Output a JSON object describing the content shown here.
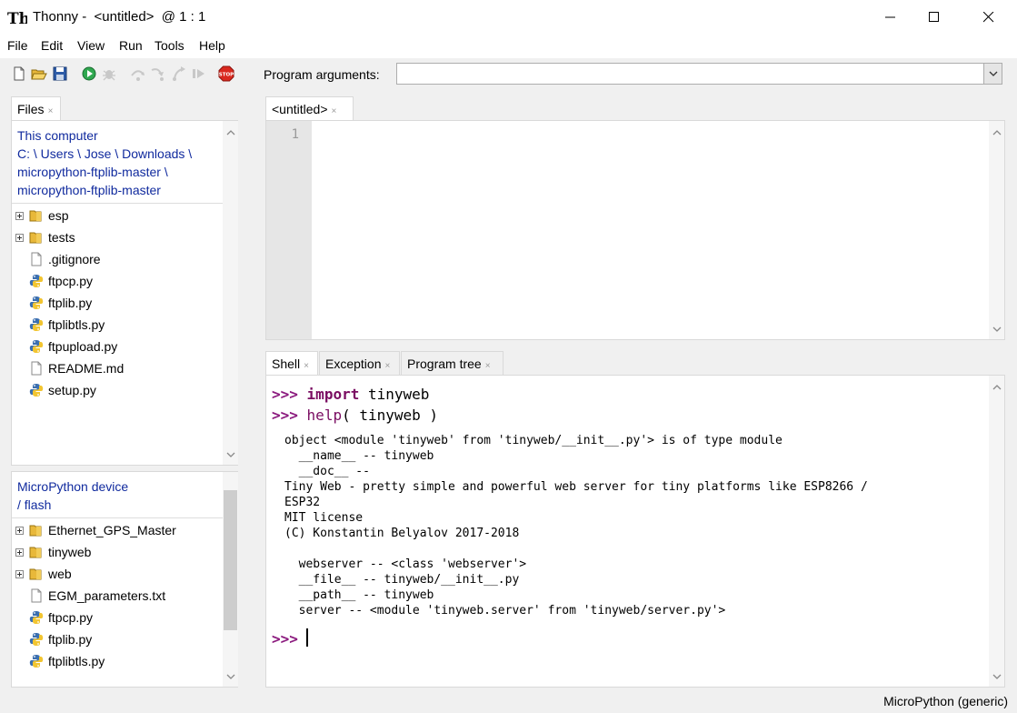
{
  "window": {
    "app_name": "Thonny",
    "title_separator": " -  ",
    "doc_name": "<untitled>",
    "position": "@  1 : 1"
  },
  "menu": [
    "File",
    "Edit",
    "View",
    "Run",
    "Tools",
    "Help"
  ],
  "toolbar": {
    "icons": [
      "new-file-icon",
      "open-file-icon",
      "save-icon",
      "run-icon",
      "debug-icon",
      "step-over-icon",
      "step-into-icon",
      "step-out-icon",
      "resume-icon",
      "stop-icon"
    ],
    "program_args_label": "Program arguments:",
    "program_args_value": ""
  },
  "files_panel": {
    "tab_label": "Files",
    "computer": {
      "heading": "This computer",
      "path_line1": "C: \\ Users \\ Jose \\ Downloads \\",
      "path_line2": "micropython-ftplib-master \\",
      "path_line3": "micropython-ftplib-master",
      "items": [
        {
          "name": "esp",
          "type": "folder"
        },
        {
          "name": "tests",
          "type": "folder"
        },
        {
          "name": ".gitignore",
          "type": "file"
        },
        {
          "name": "ftpcp.py",
          "type": "python"
        },
        {
          "name": "ftplib.py",
          "type": "python"
        },
        {
          "name": "ftplibtls.py",
          "type": "python"
        },
        {
          "name": "ftpupload.py",
          "type": "python"
        },
        {
          "name": "README.md",
          "type": "file"
        },
        {
          "name": "setup.py",
          "type": "python"
        }
      ]
    },
    "device": {
      "heading": "MicroPython device",
      "path": "/ flash",
      "items": [
        {
          "name": "Ethernet_GPS_Master",
          "type": "folder"
        },
        {
          "name": "tinyweb",
          "type": "folder"
        },
        {
          "name": "web",
          "type": "folder"
        },
        {
          "name": "EGM_parameters.txt",
          "type": "file"
        },
        {
          "name": "ftpcp.py",
          "type": "python"
        },
        {
          "name": "ftplib.py",
          "type": "python"
        },
        {
          "name": "ftplibtls.py",
          "type": "python"
        }
      ]
    }
  },
  "editor": {
    "tab_label": "<untitled>",
    "line_number": "1"
  },
  "bottom_tabs": [
    "Shell",
    "Exception",
    "Program tree"
  ],
  "shell": {
    "prompt": ">>>",
    "line1_kw": "import",
    "line1_rest": " tinyweb",
    "line2_fn": "help",
    "line2_rest": "( tinyweb )",
    "output": "object <module 'tinyweb' from 'tinyweb/__init__.py'> is of type module\n  __name__ -- tinyweb\n  __doc__ --\nTiny Web - pretty simple and powerful web server for tiny platforms like ESP8266 /\nESP32\nMIT license\n(C) Konstantin Belyalov 2017-2018\n\n  webserver -- <class 'webserver'>\n  __file__ -- tinyweb/__init__.py\n  __path__ -- tinyweb\n  server -- <module 'tinyweb.server' from 'tinyweb/server.py'>"
  },
  "status": {
    "interpreter": "MicroPython (generic)"
  }
}
